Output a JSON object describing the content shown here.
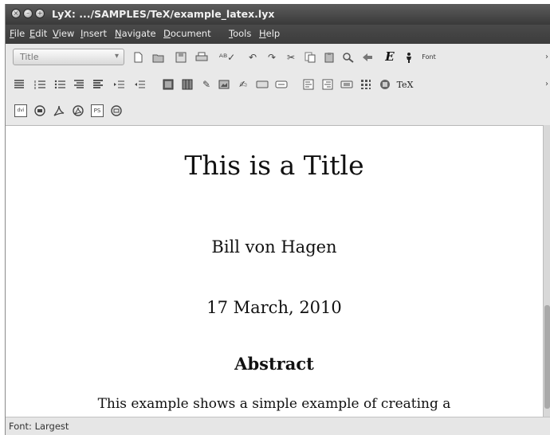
{
  "window": {
    "title": "LyX: .../SAMPLES/TeX/example_latex.lyx",
    "buttons": [
      {
        "name": "close-button",
        "glyph": "×"
      },
      {
        "name": "minimize-button",
        "glyph": "–"
      },
      {
        "name": "maximize-button",
        "glyph": "+"
      }
    ]
  },
  "menubar": {
    "items": [
      "File",
      "Edit",
      "View",
      "Insert",
      "Navigate",
      "Document",
      "Tools",
      "Help"
    ]
  },
  "toolbar": {
    "paragraph_style": "Title",
    "font_label": "Font",
    "emph_label": "E",
    "tex_label": "TeX",
    "row1_icons": [
      "new-document-icon",
      "open-document-icon",
      "save-icon",
      "print-icon",
      "spellcheck-icon",
      "undo-icon",
      "redo-icon",
      "cut-icon",
      "copy-icon",
      "paste-icon",
      "find-replace-icon",
      "navigate-back-icon",
      "emphasis-icon",
      "noun-icon",
      "font-icon",
      "overflow-chevron-icon"
    ],
    "row2_icons": [
      "paragraph-standard-icon",
      "numbered-list-icon",
      "itemize-list-icon",
      "description-list-icon",
      "enumerate-list-icon",
      "increase-depth-icon",
      "decrease-depth-icon",
      "insert-graphics-icon",
      "insert-table-icon",
      "insert-math-icon",
      "insert-figure-icon",
      "insert-footnote-icon",
      "insert-note-icon",
      "align-left-icon",
      "align-right-icon",
      "insert-label-icon",
      "insert-matrix-icon",
      "insert-cross-ref-icon",
      "tex-icon",
      "overflow-chevron-icon"
    ],
    "row3_icons": [
      "view-dvi-icon",
      "update-dvi-icon",
      "view-pdf-icon",
      "update-pdf-icon",
      "view-ps-icon",
      "update-ps-icon"
    ],
    "row3_labels": {
      "dvi": "dvi",
      "ps": "PS"
    }
  },
  "document": {
    "title": "This is a Title",
    "author": "Bill von Hagen",
    "date": "17 March, 2010",
    "abstract_heading": "Abstract",
    "body_first_line": "This example shows a simple example of creating a"
  },
  "status": {
    "text": "Font: Largest"
  }
}
